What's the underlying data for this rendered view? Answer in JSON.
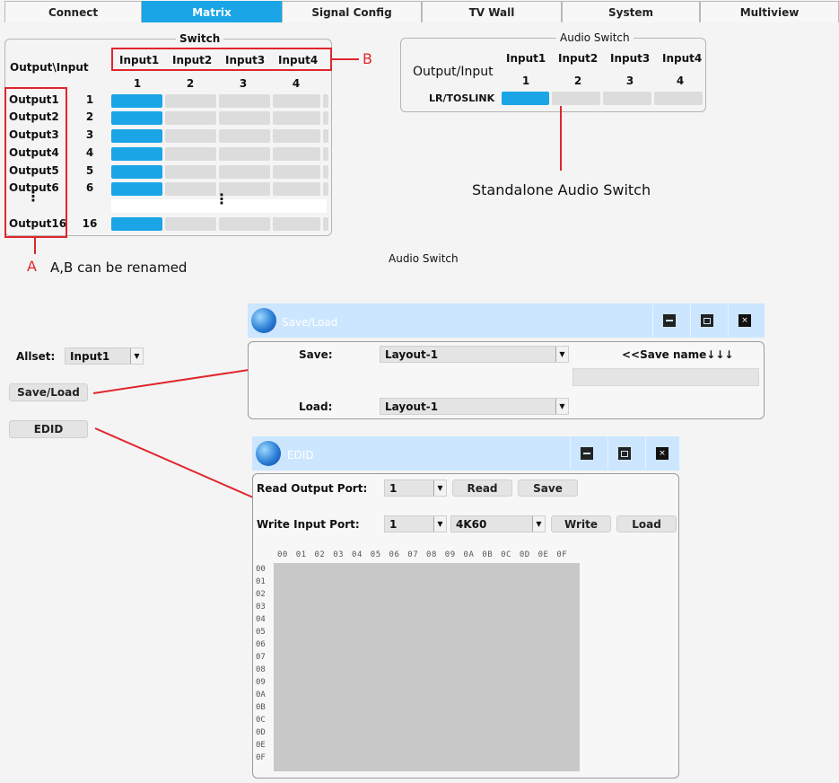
{
  "tabs": [
    {
      "label": "Connect",
      "active": false
    },
    {
      "label": "Matrix",
      "active": true
    },
    {
      "label": "Signal Config",
      "active": false
    },
    {
      "label": "TV Wall",
      "active": false
    },
    {
      "label": "System",
      "active": false
    },
    {
      "label": "Multiview",
      "active": false
    }
  ],
  "switch": {
    "title": "Switch",
    "corner": "Output\\Input",
    "inputs": [
      "Input1",
      "Input2",
      "Input3",
      "Input4"
    ],
    "input_numbers": [
      "1",
      "2",
      "3",
      "4"
    ],
    "outputs": [
      {
        "name": "Output1",
        "num": "1"
      },
      {
        "name": "Output2",
        "num": "2"
      },
      {
        "name": "Output3",
        "num": "3"
      },
      {
        "name": "Output4",
        "num": "4"
      },
      {
        "name": "Output5",
        "num": "5"
      },
      {
        "name": "Output6",
        "num": "6"
      },
      {
        "name": "Output16",
        "num": "16"
      }
    ]
  },
  "audio_switch": {
    "title": "Audio Switch",
    "corner": "Output/Input",
    "inputs": [
      "Input1",
      "Input2",
      "Input3",
      "Input4"
    ],
    "input_numbers": [
      "1",
      "2",
      "3",
      "4"
    ],
    "row_label": "LR/TOSLINK"
  },
  "annotations": {
    "label_a": "A",
    "label_b": "B",
    "rename_note": "A,B can be renamed",
    "standalone": "Standalone Audio Switch",
    "audio_switch_caption": "Audio Switch"
  },
  "sidebar": {
    "allset_label": "Allset:",
    "allset_value": "Input1",
    "save_load_button": "Save/Load",
    "edid_button": "EDID"
  },
  "save_load_window": {
    "title": "Save/Load",
    "save_label": "Save:",
    "save_value": "Layout-1",
    "save_name_hint": "<<Save name↓↓↓",
    "load_label": "Load:",
    "load_value": "Layout-1"
  },
  "edid_window": {
    "title": "EDID",
    "read_label": "Read Output Port:",
    "read_port": "1",
    "read_button": "Read",
    "save_button": "Save",
    "write_label": "Write Input Port:",
    "write_port": "1",
    "write_format": "4K60",
    "write_button": "Write",
    "load_button": "Load",
    "col_headers": "00 01 02 03 04 05 06 07 08 09 0A 0B 0C 0D 0E 0F",
    "row_headers": [
      "00",
      "01",
      "02",
      "03",
      "04",
      "05",
      "06",
      "07",
      "08",
      "09",
      "0A",
      "0B",
      "0C",
      "0D",
      "0E",
      "0F"
    ]
  },
  "colors": {
    "accent": "#1aa5e6",
    "annotation": "#e0262c",
    "title_bar": "#cce6ff"
  }
}
